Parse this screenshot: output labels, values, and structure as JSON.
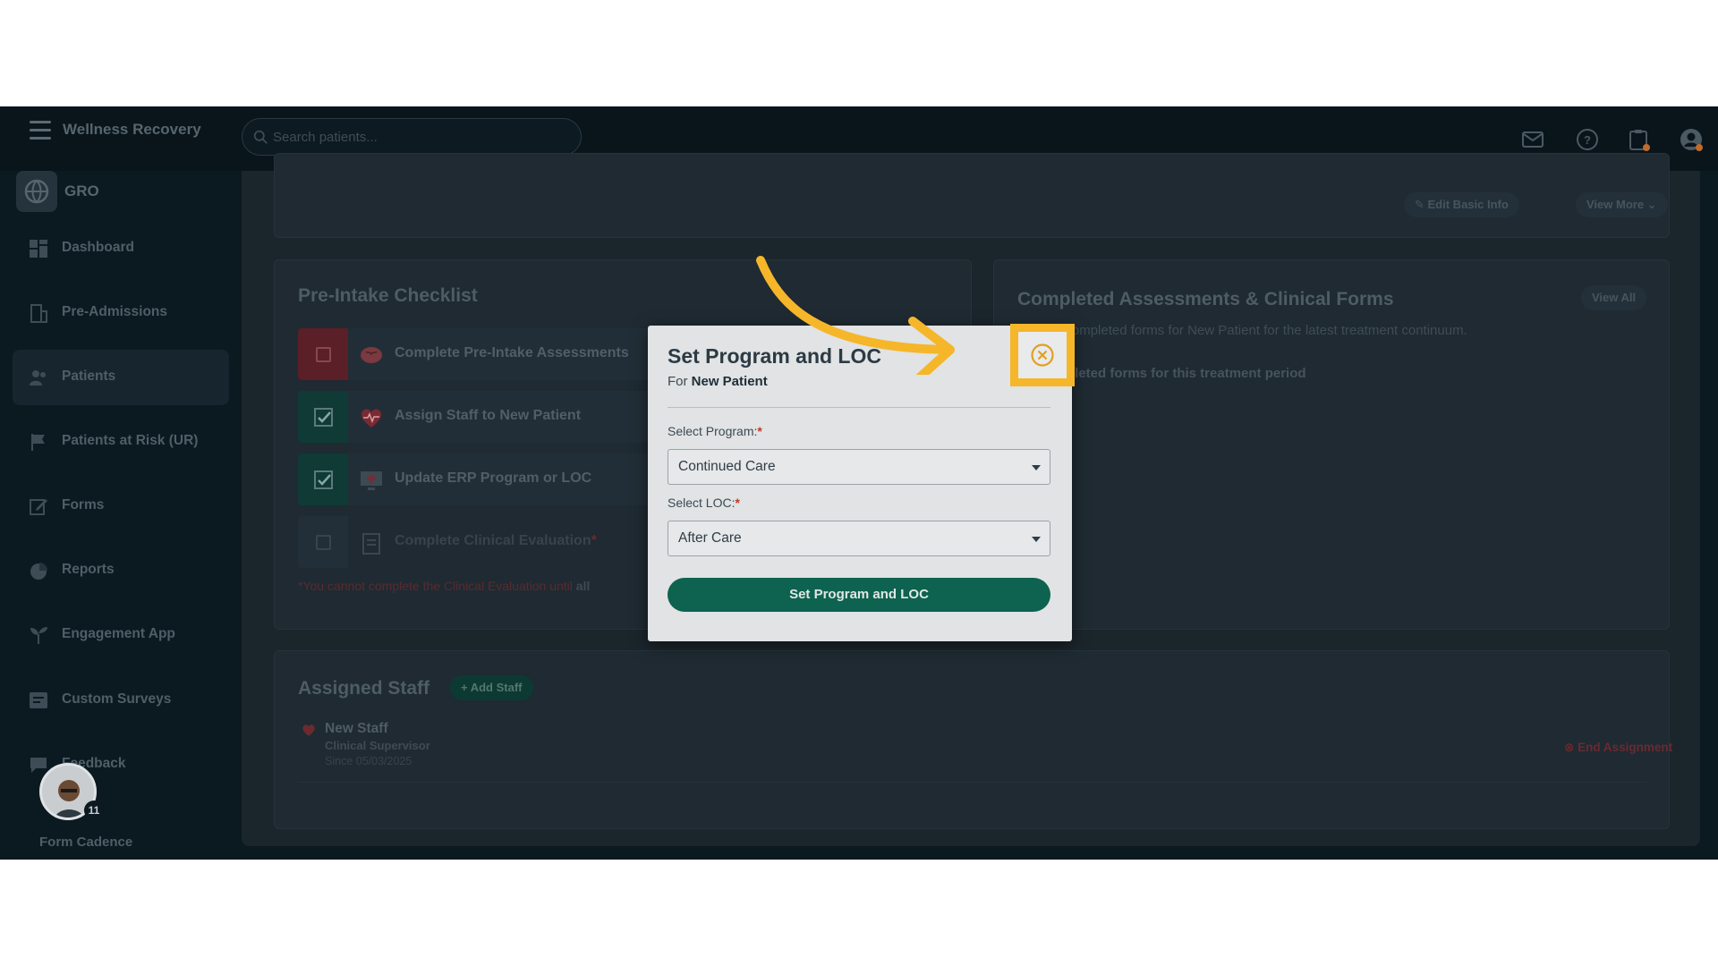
{
  "topbar": {
    "brand": "Wellness Recovery",
    "search_placeholder": "Search patients..."
  },
  "sidebar": {
    "org_name": "GRO",
    "items": [
      {
        "label": "Dashboard",
        "icon": "dashboard-icon"
      },
      {
        "label": "Pre-Admissions",
        "icon": "building-icon"
      },
      {
        "label": "Patients",
        "icon": "users-icon",
        "active": true
      },
      {
        "label": "Patients at Risk (UR)",
        "icon": "flag-icon"
      },
      {
        "label": "Forms",
        "icon": "edit-icon"
      },
      {
        "label": "Reports",
        "icon": "pie-chart-icon"
      },
      {
        "label": "Engagement App",
        "icon": "sprout-icon"
      },
      {
        "label": "Custom Surveys",
        "icon": "survey-icon"
      },
      {
        "label": "Feedback",
        "icon": "feedback-icon"
      }
    ],
    "form_cadence": {
      "label": "Form Cadence",
      "count": "11"
    }
  },
  "patient_header": {
    "edit_basic_info": "Edit Basic Info",
    "view_more": "View More"
  },
  "pre_intake": {
    "title": "Pre-Intake Checklist",
    "items": [
      {
        "label": "Complete Pre-Intake Assessments",
        "checked": false
      },
      {
        "label": "Assign Staff to New Patient",
        "checked": true
      },
      {
        "label": "Update ERP Program or LOC",
        "checked": true
      },
      {
        "label": "Complete Clinical Evaluation",
        "checked": false
      }
    ],
    "note_prefix": "*You cannot complete the Clinical Evaluation until",
    "note_bold": "all"
  },
  "completed": {
    "title": "Completed Assessments & Clinical Forms",
    "view_all": "View All",
    "description": "Last 10 completed forms for New Patient for the latest treatment continuum.",
    "empty": "No completed forms for this treatment period"
  },
  "assigned_staff": {
    "title": "Assigned Staff",
    "add_button": "+ Add Staff",
    "staff": {
      "name": "New Staff",
      "role": "Clinical Supervisor",
      "since": "Since 05/03/2025"
    },
    "end_assignment": "End Assignment"
  },
  "modal": {
    "title": "Set Program and LOC",
    "subtitle_prefix": "For",
    "subtitle_name": "New Patient",
    "program_label": "Select Program:",
    "program_value": "Continued Care",
    "loc_label": "Select LOC:",
    "loc_value": "After Care",
    "required_mark": "*",
    "submit_label": "Set Program and LOC"
  },
  "colors": {
    "accent_green": "#0e6250",
    "highlight": "#f5b62a",
    "required": "#c0392b"
  }
}
